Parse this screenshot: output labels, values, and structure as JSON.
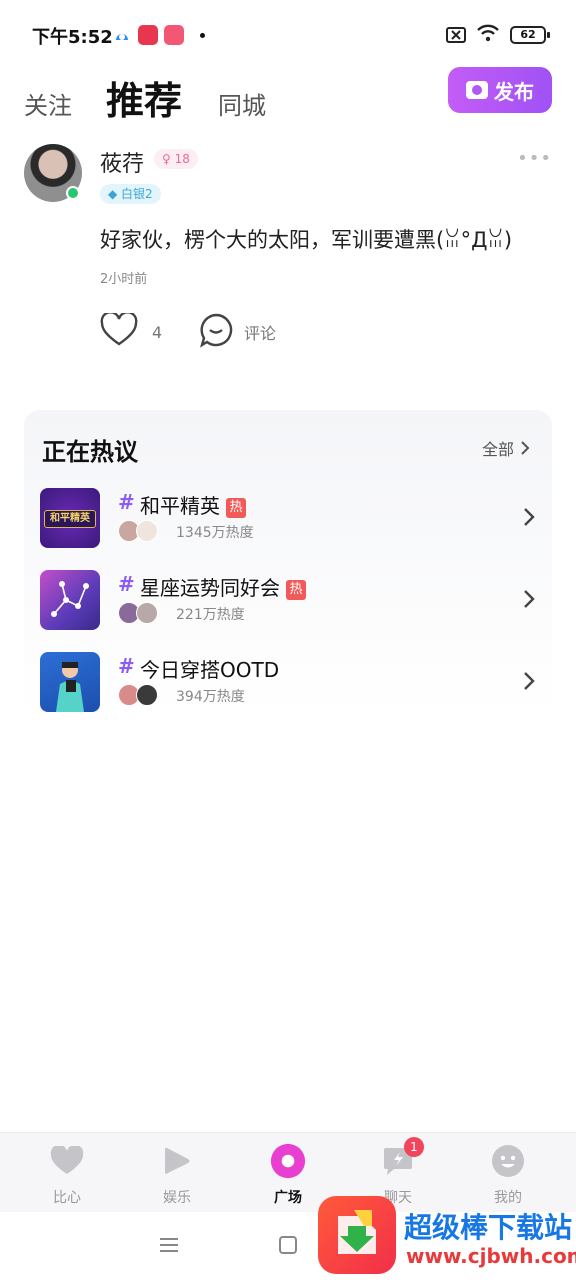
{
  "status_bar": {
    "time": "下午5:52",
    "battery": "62"
  },
  "tabs": {
    "follow": "关注",
    "recommend": "推荐",
    "city": "同城"
  },
  "publish_button": {
    "label": "发布"
  },
  "post": {
    "username": "莜荇",
    "age": "18",
    "level": "白银2",
    "text": "好家伙，楞个大的太阳，军训要遭黑(ꈍ°Дꈍ)",
    "time": "2小时前",
    "likes": "4",
    "comment_label": "评论"
  },
  "hot_topics": {
    "title": "正在热议",
    "all_label": "全部",
    "items": [
      {
        "hash": "#",
        "name": "和平精英",
        "hot": "热",
        "heat": "1345万热度",
        "thumb_text": "和平精英"
      },
      {
        "hash": "#",
        "name": "星座运势同好会",
        "hot": "热",
        "heat": "221万热度"
      },
      {
        "hash": "#",
        "name": "今日穿搭OOTD",
        "heat": "394万热度"
      }
    ]
  },
  "bottom_nav": {
    "items": [
      {
        "label": "比心"
      },
      {
        "label": "娱乐"
      },
      {
        "label": "广场"
      },
      {
        "label": "聊天",
        "badge": "1"
      },
      {
        "label": "我的"
      }
    ]
  },
  "watermark": {
    "text": "超级棒下载站",
    "url": "www.cjbwh.com"
  },
  "colors": {
    "accent": "#a855f7",
    "hot_tag": "#f25a5a",
    "topic_hash": "#8b5cf6",
    "nav_active": "#e83fd0"
  }
}
